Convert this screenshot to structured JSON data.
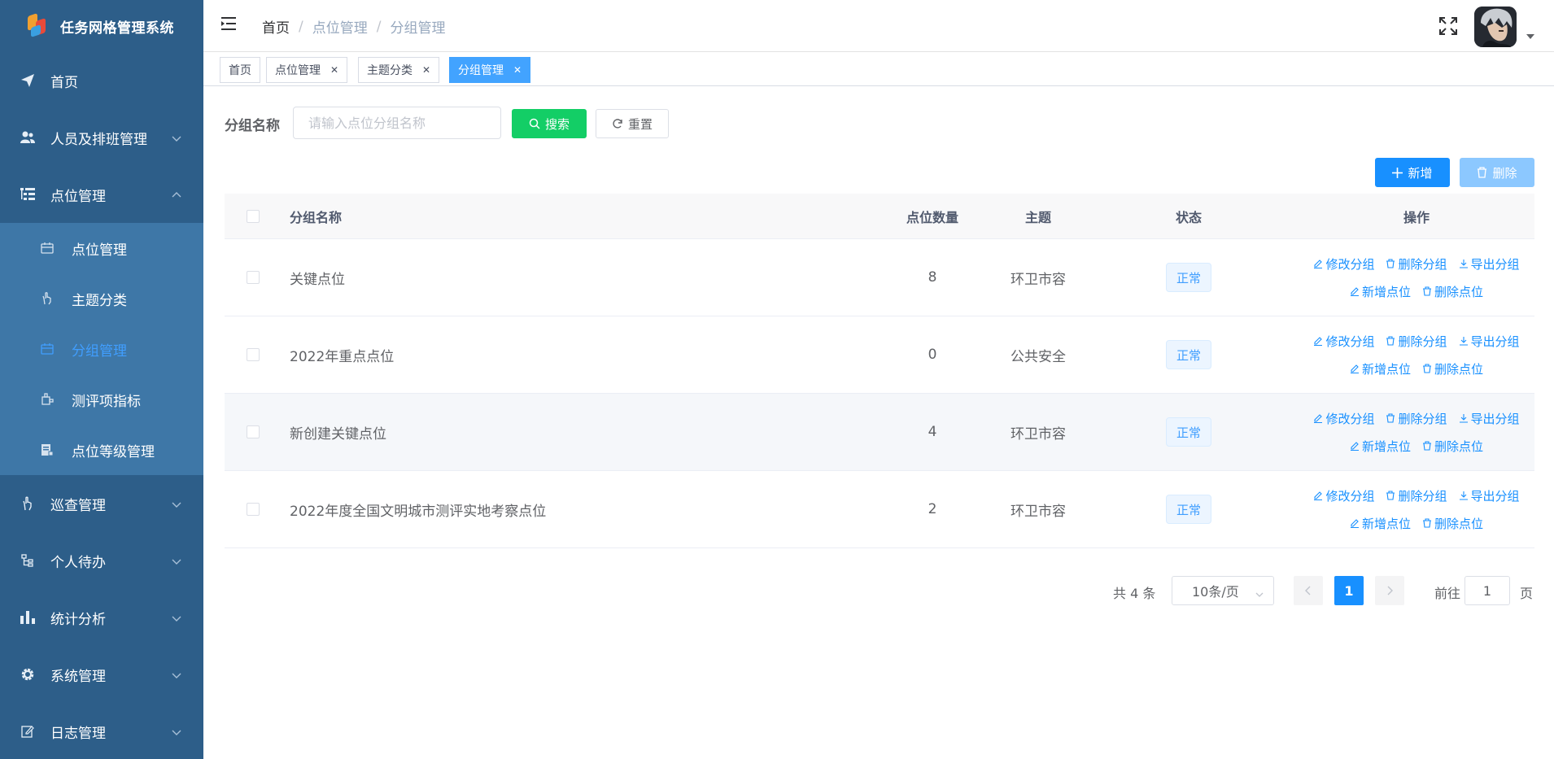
{
  "app": {
    "title": "任务网格管理系统"
  },
  "sidebar": {
    "items": [
      {
        "label": "首页",
        "icon": "paper-plane-icon"
      },
      {
        "label": "人员及排班管理",
        "icon": "users-icon"
      },
      {
        "label": "点位管理",
        "icon": "tree-list-icon",
        "expanded": true
      }
    ],
    "sub_items": [
      {
        "label": "点位管理",
        "icon": "calendar-icon"
      },
      {
        "label": "主题分类",
        "icon": "hand-icon"
      },
      {
        "label": "分组管理",
        "icon": "calendar-icon",
        "active": true
      },
      {
        "label": "测评项指标",
        "icon": "plugin-icon"
      },
      {
        "label": "点位等级管理",
        "icon": "document-icon"
      }
    ],
    "items_after": [
      {
        "label": "巡查管理",
        "icon": "hand-icon"
      },
      {
        "label": "个人待办",
        "icon": "tree-icon"
      },
      {
        "label": "统计分析",
        "icon": "bar-chart-icon"
      },
      {
        "label": "系统管理",
        "icon": "gear-icon"
      },
      {
        "label": "日志管理",
        "icon": "edit-icon"
      }
    ]
  },
  "header": {
    "breadcrumb": [
      "首页",
      "点位管理",
      "分组管理"
    ]
  },
  "tags": [
    {
      "label": "首页",
      "closable": false
    },
    {
      "label": "点位管理",
      "closable": true
    },
    {
      "label": "主题分类",
      "closable": true
    },
    {
      "label": "分组管理",
      "closable": true,
      "active": true
    }
  ],
  "search": {
    "label": "分组名称",
    "placeholder": "请输入点位分组名称",
    "search_btn": "搜索",
    "reset_btn": "重置"
  },
  "toolbar": {
    "add_btn": "新增",
    "delete_btn": "删除"
  },
  "table": {
    "headers": {
      "name": "分组名称",
      "count": "点位数量",
      "theme": "主题",
      "status": "状态",
      "ops": "操作"
    },
    "rows": [
      {
        "name": "关键点位",
        "count": "8",
        "theme": "环卫市容",
        "status": "正常"
      },
      {
        "name": "2022年重点点位",
        "count": "0",
        "theme": "公共安全",
        "status": "正常"
      },
      {
        "name": "新创建关键点位",
        "count": "4",
        "theme": "环卫市容",
        "status": "正常"
      },
      {
        "name": "2022年度全国文明城市测评实地考察点位",
        "count": "2",
        "theme": "环卫市容",
        "status": "正常"
      }
    ],
    "ops": {
      "edit": "修改分组",
      "delete": "删除分组",
      "export": "导出分组",
      "add_point": "新增点位",
      "delete_point": "删除点位"
    }
  },
  "pagination": {
    "total": "共 4 条",
    "page_size": "10条/页",
    "current": "1",
    "goto_label": "前往",
    "goto_value": "1",
    "suffix": "页"
  },
  "colors": {
    "sidebar_bg": "#2d5e89",
    "submenu_bg": "#3e77a7",
    "primary": "#1890ff",
    "success": "#13ce66",
    "active_tag": "#42a3ff"
  }
}
